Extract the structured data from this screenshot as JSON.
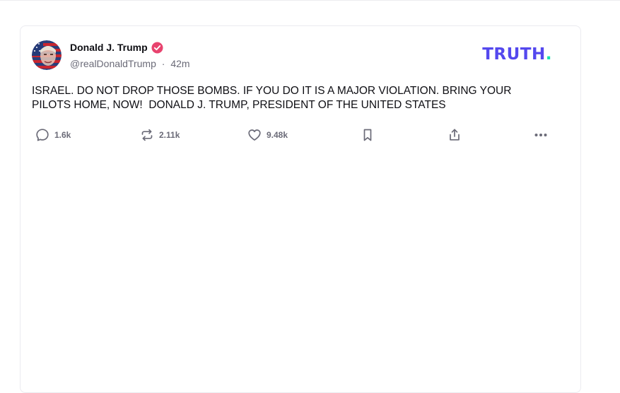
{
  "post": {
    "author_name": "Donald J. Trump",
    "handle": "@realDonaldTrump",
    "separator": "·",
    "time_ago": "42m",
    "verified_icon": "verified-badge-icon",
    "body": "ISRAEL. DO NOT DROP THOSE BOMBS. IF YOU DO IT IS A MAJOR VIOLATION. BRING YOUR PILOTS HOME, NOW!  DONALD J. TRUMP, PRESIDENT OF THE UNITED STATES"
  },
  "brand": {
    "logo_text": "TRUTH",
    "logo_dot": ".",
    "primary_color": "#5448ee",
    "dot_color": "#17e3b0"
  },
  "actions": {
    "replies": {
      "icon": "reply-icon",
      "count": "1.6k"
    },
    "retruths": {
      "icon": "retruth-icon",
      "count": "2.11k"
    },
    "likes": {
      "icon": "heart-icon",
      "count": "9.48k"
    },
    "bookmark": {
      "icon": "bookmark-icon"
    },
    "share": {
      "icon": "share-icon"
    },
    "more": {
      "icon": "more-icon"
    }
  }
}
